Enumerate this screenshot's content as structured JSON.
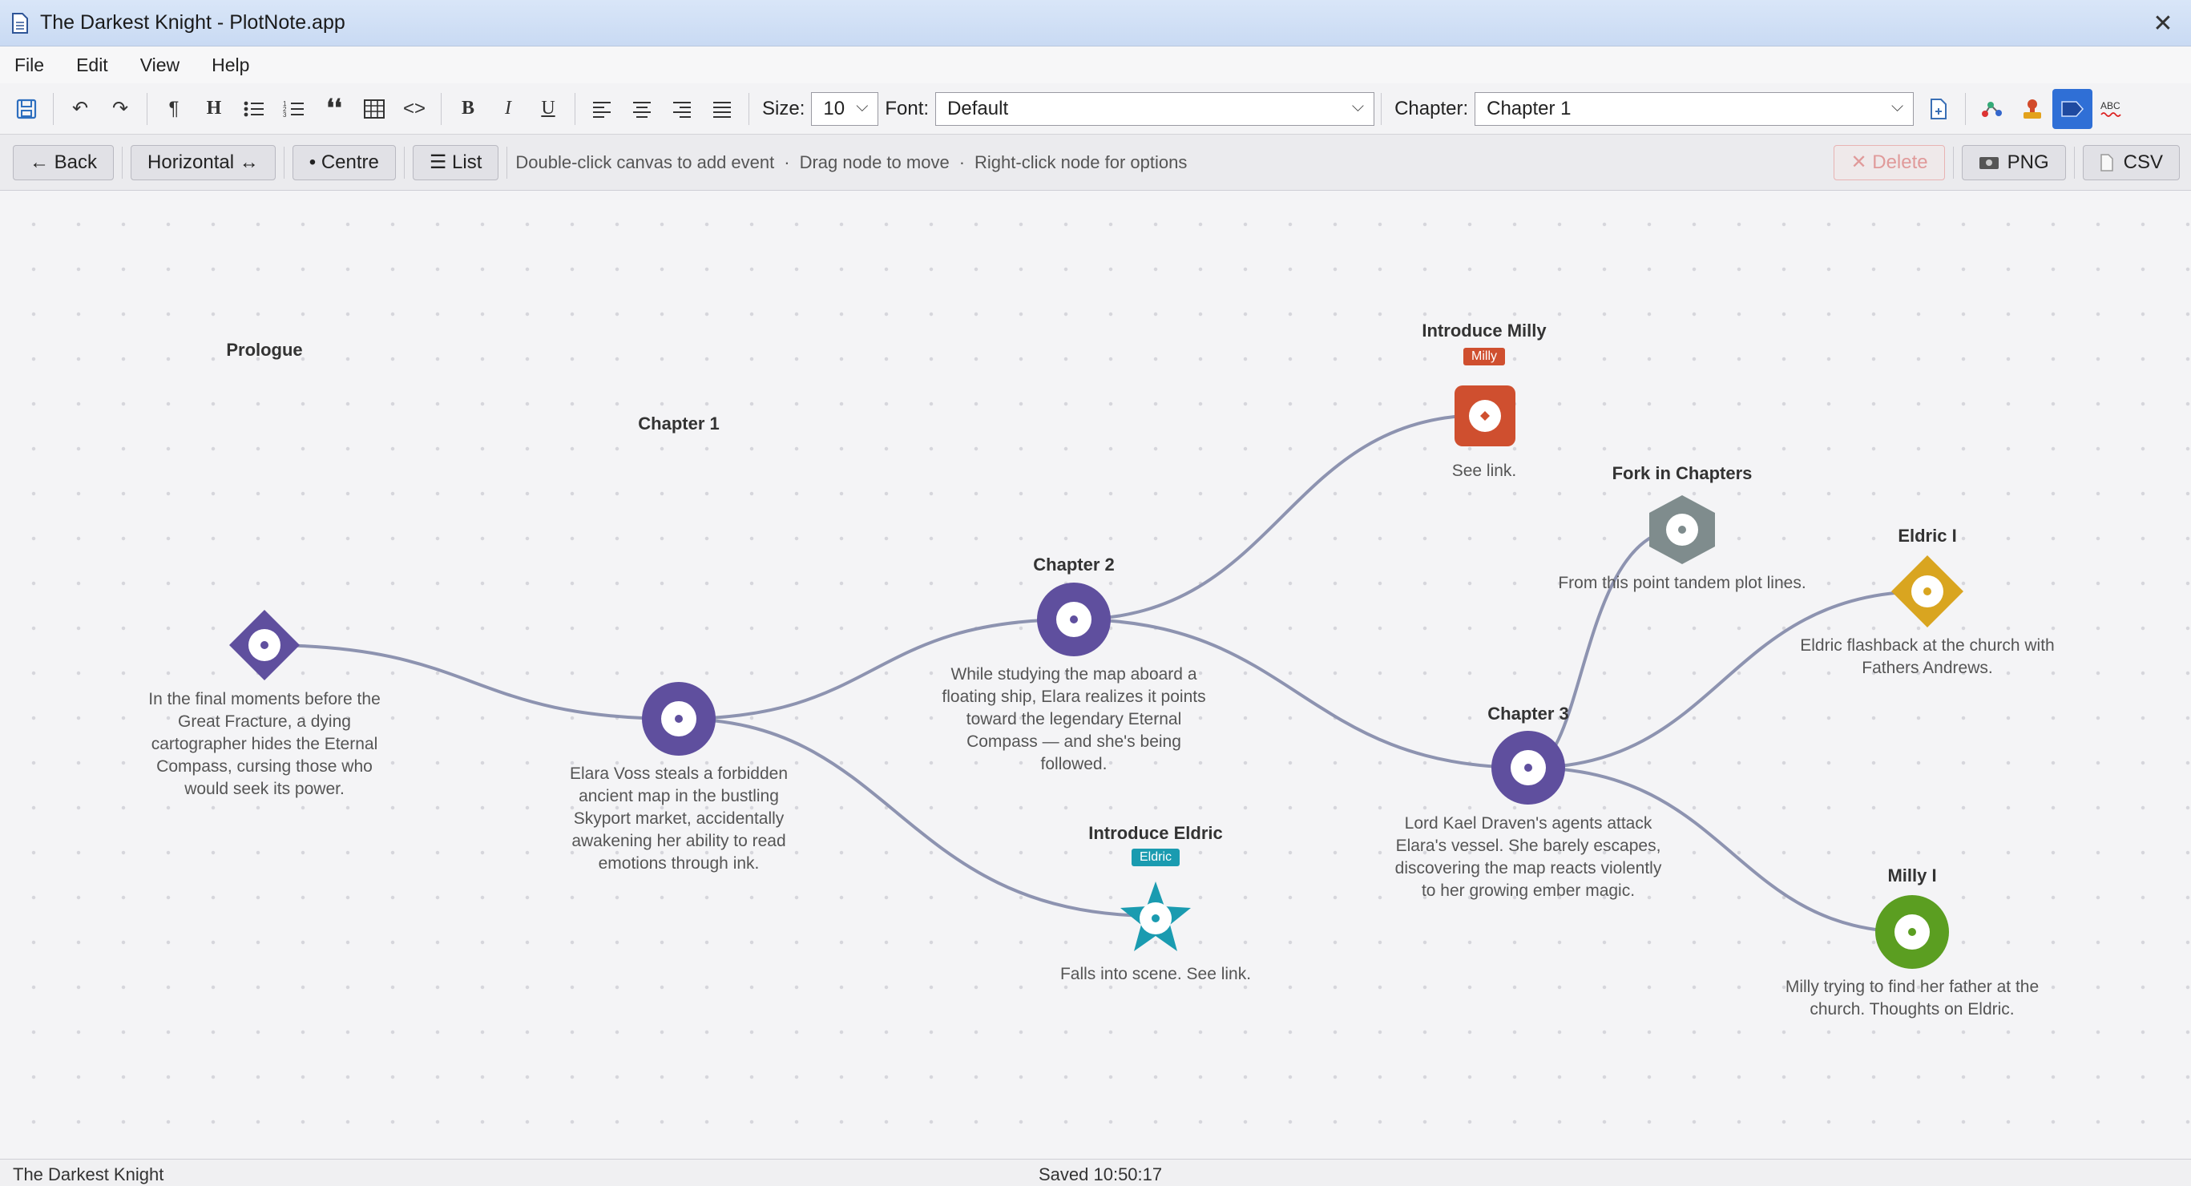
{
  "window": {
    "title": "The Darkest Knight - PlotNote.app"
  },
  "menu": [
    "File",
    "Edit",
    "View",
    "Help"
  ],
  "toolbar": {
    "size_label": "Size:",
    "size_value": "10",
    "font_label": "Font:",
    "font_value": "Default",
    "chapter_label": "Chapter:",
    "chapter_value": "Chapter 1"
  },
  "actions": {
    "back": "← Back",
    "horizontal": "Horizontal ↔",
    "centre": "• Centre",
    "list": "☰ List",
    "hint1": "Double-click canvas to add event",
    "hint2": "Drag node to move",
    "hint3": "Right-click node for options",
    "sep": "·",
    "delete": "✕ Delete",
    "png": "PNG",
    "csv": "CSV"
  },
  "nodes": {
    "prologue": {
      "title": "Prologue",
      "desc": "In the final moments before the Great Fracture, a dying cartographer hides the Eternal Compass, cursing those who would seek its power.",
      "color": "#5f4f9e"
    },
    "chapter1": {
      "title": "Chapter 1",
      "desc": "Elara Voss steals a forbidden ancient map in the bustling Skyport market, accidentally awakening her ability to read emotions through ink.",
      "color": "#5f4f9e"
    },
    "chapter2": {
      "title": "Chapter 2",
      "desc": "While studying the map aboard a floating ship, Elara realizes it points toward the legendary Eternal Compass — and she's being followed.",
      "color": "#5f4f9e"
    },
    "introduce_milly": {
      "title": "Introduce Milly",
      "tag": "Milly",
      "desc": "See link.",
      "color": "#cf4f2f"
    },
    "introduce_eldric": {
      "title": "Introduce Eldric",
      "tag": "Eldric",
      "desc": "Falls into scene. See link.",
      "color": "#1a9bb0"
    },
    "fork": {
      "title": "Fork in Chapters",
      "desc": "From this point tandem plot lines.",
      "color": "#7f8c8d"
    },
    "chapter3": {
      "title": "Chapter 3",
      "desc": "Lord Kael Draven's agents attack Elara's vessel. She barely escapes, discovering the map reacts violently to her growing ember magic.",
      "color": "#5f4f9e"
    },
    "eldric1": {
      "title": "Eldric I",
      "desc": "Eldric flashback at the church with Fathers Andrews.",
      "color": "#d9a520"
    },
    "milly1": {
      "title": "Milly I",
      "desc": "Milly trying to find her father at the church. Thoughts on Eldric.",
      "color": "#5b9e21"
    }
  },
  "link_color": "#8d93b0",
  "status": {
    "project": "The Darkest Knight",
    "saved": "Saved 10:50:17"
  }
}
